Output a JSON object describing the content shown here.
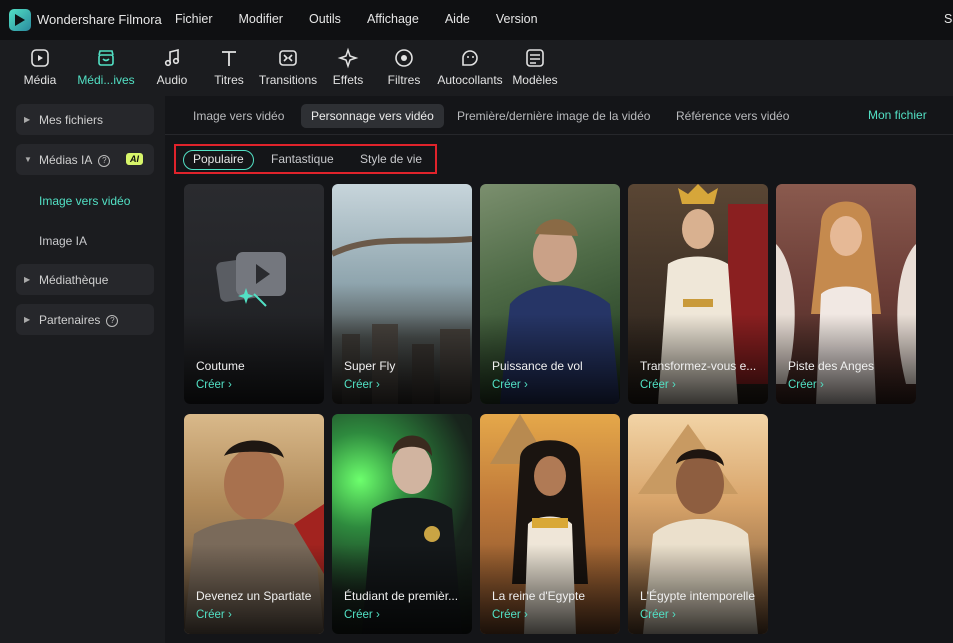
{
  "app": {
    "name": "Wondershare Filmora",
    "title_right": "Sa"
  },
  "menu": [
    "Fichier",
    "Modifier",
    "Outils",
    "Affichage",
    "Aide",
    "Version"
  ],
  "toolbar": [
    {
      "label": "Média",
      "icon": "media-icon"
    },
    {
      "label": "Médi...ives",
      "icon": "stock-media-icon",
      "active": true
    },
    {
      "label": "Audio",
      "icon": "music-note-icon"
    },
    {
      "label": "Titres",
      "icon": "text-t-icon"
    },
    {
      "label": "Transitions",
      "icon": "transition-icon"
    },
    {
      "label": "Effets",
      "icon": "sparkle-icon"
    },
    {
      "label": "Filtres",
      "icon": "filter-icon"
    },
    {
      "label": "Autocollants",
      "icon": "sticker-icon"
    },
    {
      "label": "Modèles",
      "icon": "template-icon"
    }
  ],
  "sidebar": {
    "mes_fichiers": "Mes fichiers",
    "medias_ia": "Médias IA",
    "ai_badge": "AI",
    "sub_image_video": "Image vers vidéo",
    "sub_image_ia": "Image IA",
    "mediatheque": "Médiathèque",
    "partenaires": "Partenaires"
  },
  "tabs": [
    "Image vers vidéo",
    "Personnage vers vidéo",
    "Première/dernière image de la vidéo",
    "Référence vers vidéo"
  ],
  "active_tab": "Personnage vers vidéo",
  "mon_fichier": "Mon fichier",
  "filters": [
    "Populaire",
    "Fantastique",
    "Style de vie"
  ],
  "active_filter": "Populaire",
  "cta": "Créer ›",
  "cards": [
    "Coutume",
    "Super Fly",
    "Puissance de vol",
    "Transformez-vous e...",
    "Piste des Anges",
    "Devenez un Spartiate",
    "Étudiant de premièr...",
    "La reine d'Egypte",
    "L'Égypte intemporelle"
  ],
  "colors": {
    "accent": "#52e0c4",
    "highlight_border": "#e0232b",
    "ai_badge": "#d7f56a"
  }
}
